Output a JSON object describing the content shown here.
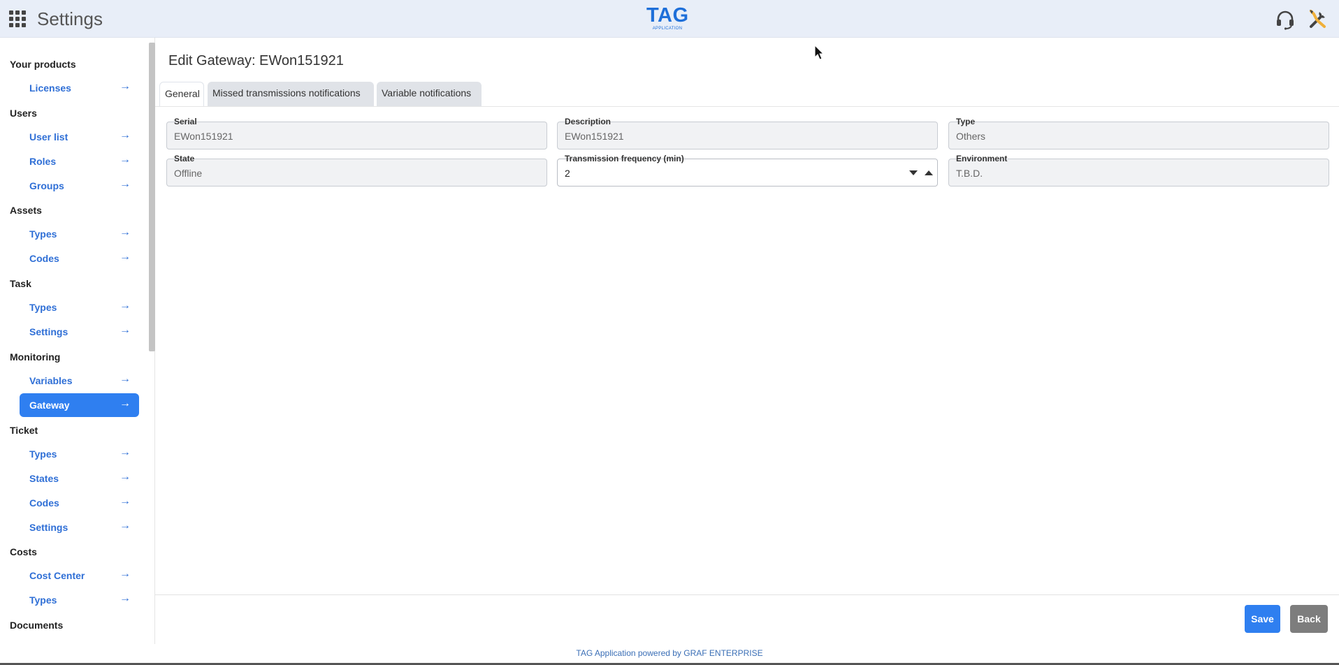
{
  "header": {
    "title": "Settings",
    "logo_text": "TAG",
    "logo_subtext": "APPLICATION"
  },
  "sidebar": {
    "groups": [
      {
        "label": "Your products",
        "items": [
          {
            "label": "Licenses"
          }
        ]
      },
      {
        "label": "Users",
        "items": [
          {
            "label": "User list"
          },
          {
            "label": "Roles"
          },
          {
            "label": "Groups"
          }
        ]
      },
      {
        "label": "Assets",
        "items": [
          {
            "label": "Types"
          },
          {
            "label": "Codes"
          }
        ]
      },
      {
        "label": "Task",
        "items": [
          {
            "label": "Types"
          },
          {
            "label": "Settings"
          }
        ]
      },
      {
        "label": "Monitoring",
        "items": [
          {
            "label": "Variables"
          },
          {
            "label": "Gateway",
            "active": true
          }
        ]
      },
      {
        "label": "Ticket",
        "items": [
          {
            "label": "Types"
          },
          {
            "label": "States"
          },
          {
            "label": "Codes"
          },
          {
            "label": "Settings"
          }
        ]
      },
      {
        "label": "Costs",
        "items": [
          {
            "label": "Cost Center"
          },
          {
            "label": "Types"
          }
        ]
      },
      {
        "label": "Documents",
        "items": []
      }
    ],
    "arrow_glyph": "→"
  },
  "main": {
    "title": "Edit Gateway: EWon151921",
    "tabs": [
      {
        "label": "General",
        "active": true
      },
      {
        "label": "Missed transmissions notifications",
        "active": false
      },
      {
        "label": "Variable notifications",
        "active": false
      }
    ],
    "fields": {
      "serial": {
        "label": "Serial",
        "value": "EWon151921"
      },
      "description": {
        "label": "Description",
        "value": "EWon151921"
      },
      "type": {
        "label": "Type",
        "value": "Others"
      },
      "state": {
        "label": "State",
        "value": "Offline"
      },
      "transmission_frequency": {
        "label": "Transmission frequency (min)",
        "value": "2"
      },
      "environment": {
        "label": "Environment",
        "value": "T.B.D."
      }
    }
  },
  "actions": {
    "save_label": "Save",
    "back_label": "Back"
  },
  "footer": {
    "powered_by": "TAG Application powered by GRAF ENTERPRISE"
  },
  "colors": {
    "accent": "#2f7ff0",
    "header_bg": "#e8eef8",
    "link": "#2f6fd6",
    "back_button": "#7d7d7d"
  }
}
